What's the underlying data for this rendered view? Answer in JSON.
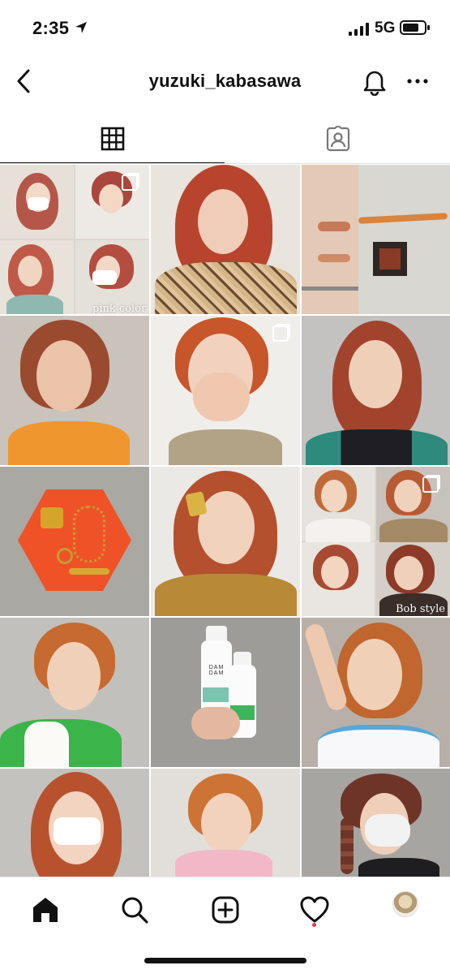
{
  "status_bar": {
    "time": "2:35",
    "network": "5G",
    "icons": [
      "location-arrow-icon",
      "signal-bars-icon",
      "battery-icon"
    ]
  },
  "header": {
    "username": "yuzuki_kabasawa",
    "icons": [
      "back-chevron-icon",
      "bell-icon",
      "more-dots-icon"
    ]
  },
  "tabs": [
    {
      "name": "posts-grid",
      "icon": "grid-icon",
      "selected": true
    },
    {
      "name": "tagged",
      "icon": "tagged-person-icon",
      "selected": false
    }
  ],
  "grid": {
    "posts": [
      {
        "overlay": "pink color",
        "multiple": true
      },
      {
        "overlay": "",
        "multiple": false
      },
      {
        "overlay": "",
        "multiple": false
      },
      {
        "overlay": "",
        "multiple": false
      },
      {
        "overlay": "",
        "multiple": true
      },
      {
        "overlay": "",
        "multiple": false
      },
      {
        "overlay": "",
        "multiple": false
      },
      {
        "overlay": "",
        "multiple": false
      },
      {
        "overlay": "Bob style",
        "multiple": true
      },
      {
        "overlay": "",
        "multiple": false
      },
      {
        "overlay": "",
        "multiple": false
      },
      {
        "overlay": "",
        "multiple": false
      },
      {
        "overlay": "",
        "multiple": false
      },
      {
        "overlay": "",
        "multiple": false
      },
      {
        "overlay": "",
        "multiple": false
      }
    ],
    "product_label": "DAM DAM"
  },
  "bottom_nav": {
    "items": [
      "home-icon",
      "search-icon",
      "new-post-icon",
      "activity-heart-icon",
      "profile-avatar"
    ],
    "activity_dot_color": "#e8364a"
  }
}
